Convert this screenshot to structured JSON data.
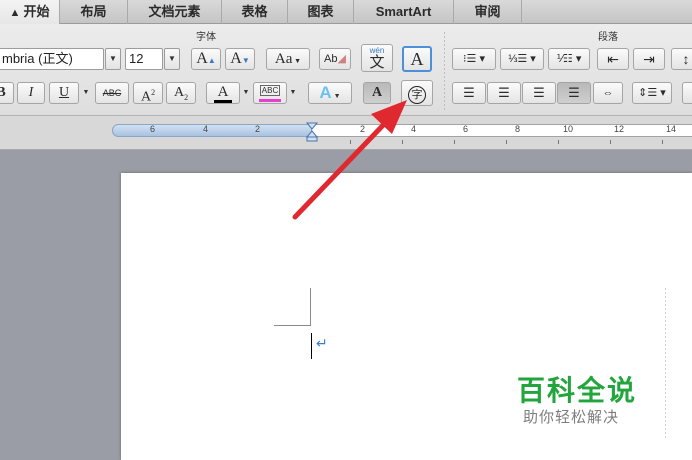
{
  "tabs": [
    {
      "label": "开始",
      "icon": "home-icon"
    },
    {
      "label": "布局"
    },
    {
      "label": "文档元素"
    },
    {
      "label": "表格"
    },
    {
      "label": "图表"
    },
    {
      "label": "SmartArt"
    },
    {
      "label": "审阅"
    }
  ],
  "ribbon": {
    "font_group_label": "字体",
    "paragraph_group_label": "段落",
    "font_name": "mbria (正文)",
    "font_size": "12",
    "grow_font_label": "A",
    "shrink_font_label": "A",
    "change_case_label": "Aa",
    "clear_format_label": "Ab",
    "phonetic_label_top": "wén",
    "phonetic_label_main": "文",
    "char_border_label": "A",
    "bold_label": "B",
    "italic_label": "I",
    "underline_label": "U",
    "strike_label": "ABC",
    "superscript_base": "A",
    "superscript_mark": "2",
    "subscript_base": "A",
    "subscript_mark": "2",
    "font_color_label": "A",
    "highlight_label": "ABC",
    "text_effect_label": "A",
    "char_shading_label": "A",
    "enclose_char_label": "字",
    "colors": {
      "font_color_bar": "#000000",
      "highlight_bar": "#e83ecf",
      "text_effect": "#6cc1f0"
    }
  },
  "ruler": {
    "labels": [
      "6",
      "4",
      "2",
      "2",
      "4",
      "6",
      "8",
      "10",
      "12",
      "14"
    ]
  },
  "document": {
    "paragraph_mark": "↵"
  },
  "watermark": {
    "title": "百科全说",
    "subtitle": "助你轻松解决"
  },
  "annotation": {
    "arrow_color": "#e0282f"
  }
}
